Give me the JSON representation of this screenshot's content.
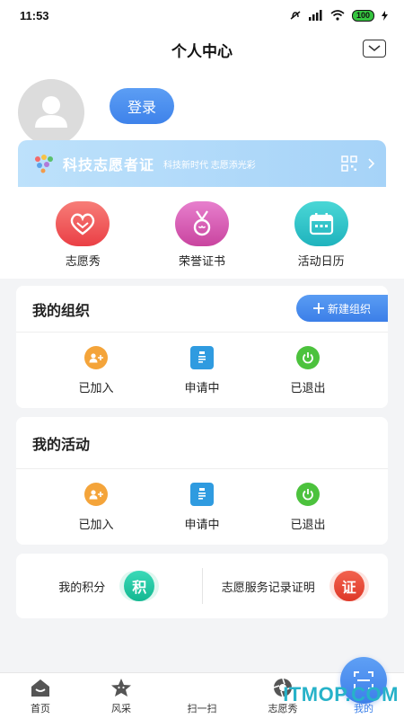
{
  "status_bar": {
    "time": "11:53",
    "battery": "100"
  },
  "header": {
    "title": "个人中心"
  },
  "profile": {
    "login_label": "登录",
    "cert_title": "科技志愿者证",
    "cert_subtitle": "科技新时代 志愿添光彩"
  },
  "quick_actions": [
    {
      "label": "志愿秀",
      "color": "#f0555a"
    },
    {
      "label": "荣誉证书",
      "color": "#d85fb0"
    },
    {
      "label": "活动日历",
      "color": "#2cc4c8"
    }
  ],
  "org_card": {
    "title": "我的组织",
    "new_button": "新建组织",
    "items": [
      {
        "label": "已加入",
        "color": "#f4a43a"
      },
      {
        "label": "申请中",
        "color": "#2f9be0"
      },
      {
        "label": "已退出",
        "color": "#4cc23d"
      }
    ]
  },
  "activity_card": {
    "title": "我的活动",
    "items": [
      {
        "label": "已加入",
        "color": "#f4a43a"
      },
      {
        "label": "申请中",
        "color": "#2f9be0"
      },
      {
        "label": "已退出",
        "color": "#4cc23d"
      }
    ]
  },
  "points": {
    "my_points": "我的积分",
    "points_badge": "积",
    "service_record": "志愿服务记录证明",
    "record_badge": "证"
  },
  "tabbar": {
    "tabs": [
      {
        "label": "首页",
        "icon": "home-icon"
      },
      {
        "label": "风采",
        "icon": "star-face-icon"
      },
      {
        "label": "扫一扫",
        "icon": "scan-icon"
      },
      {
        "label": "志愿秀",
        "icon": "aperture-icon"
      },
      {
        "label": "我的",
        "icon": "person-icon"
      }
    ]
  },
  "watermark": "ITMOP.COM",
  "colors": {
    "accent": "#3f83ea",
    "points_teal": "#1fc9a6",
    "record_red": "#e8483a"
  }
}
